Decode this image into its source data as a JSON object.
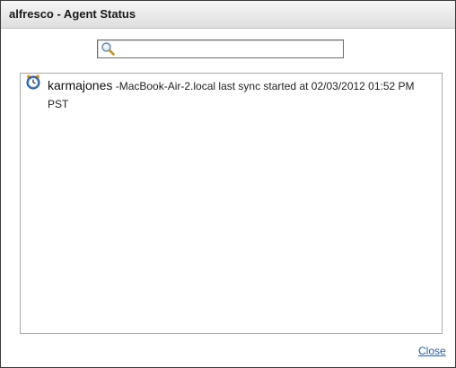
{
  "dialog": {
    "title": "alfresco - Agent Status",
    "search": {
      "icon": "magnifier-icon",
      "value": "",
      "placeholder": ""
    },
    "entries": [
      {
        "icon": "sync-clock-icon",
        "user": "karmajones",
        "message": " -MacBook-Air-2.local last sync started at 02/03/2012 01:52 PM PST"
      }
    ],
    "close_label": "Close"
  }
}
